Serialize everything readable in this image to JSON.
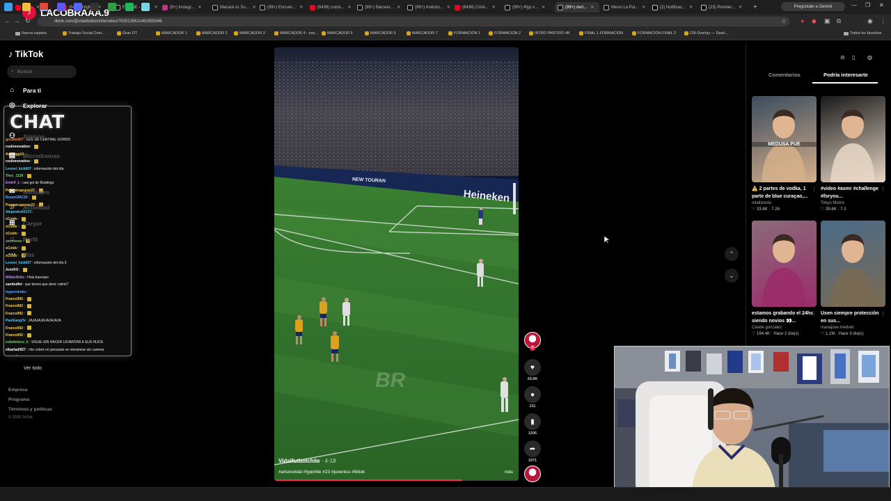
{
  "browser": {
    "tabs": [
      {
        "label": "9 B...",
        "icon": "youtube-icon"
      },
      {
        "label": "(6438) High...",
        "icon": "youtube-icon"
      },
      {
        "label": "ELNINE - Fut...",
        "icon": "page-icon"
      },
      {
        "label": "(9+) Instagr...",
        "icon": "instagram-icon"
      },
      {
        "label": "Macará vs Su...",
        "icon": "page-icon"
      },
      {
        "label": "(99+) Encuen...",
        "icon": "tiktok-icon"
      },
      {
        "label": "(6438) crack...",
        "icon": "youtube-icon"
      },
      {
        "label": "(99+) Barcelo...",
        "icon": "tiktok-icon"
      },
      {
        "label": "(99+) Anécdo...",
        "icon": "tiktok-icon"
      },
      {
        "label": "(6438) Cristi...",
        "icon": "youtube-icon"
      },
      {
        "label": "(99+) #fyp #...",
        "icon": "tiktok-icon"
      },
      {
        "label": "(99+) #art...",
        "icon": "tiktok-icon",
        "active": true
      },
      {
        "label": "Messi La Pul...",
        "icon": "tiktok-icon"
      },
      {
        "label": "(2) Notificac...",
        "icon": "x-icon"
      },
      {
        "label": "(23) Premier...",
        "icon": "x-icon"
      }
    ],
    "new_tab": "+",
    "gemini_button": "Pregúntale a Gemini",
    "url": "tiktok.com/@vidalfutbolchile/video/7630135611462659346",
    "bookmarks": [
      "Nueva carpeta",
      "Trabajo Social Com...",
      "Gran DT",
      "MARCADOR 1",
      "MARCADOR 2",
      "MARCADOR 3",
      "MARCADOR 4 - ove...",
      "MARCADOR 5",
      "MARCADOR 6",
      "MARCADOR 7",
      "FORMACION 1",
      "FORMACION 2",
      "INTRO PARTIDO 4K",
      "FINAL 1 FORMACION",
      "FORMACION FINAL 2",
      "CM Overlay — Dash..."
    ],
    "all_bookmarks": "Todos los favoritos"
  },
  "overlay": {
    "channel_name": "LACOBRAAA.9",
    "chat_title": "CHAT",
    "chat_messages": [
      {
        "user": "gordito907",
        "text": "GOL DE CENTRAL GORDO",
        "color": "#ff8a3d"
      },
      {
        "user": "rusitonovattoo",
        "text": "",
        "color": "#ffffff",
        "emote": true
      },
      {
        "user": "Aarongg10",
        "text": "",
        "color": "#ffd54a",
        "emote": false
      },
      {
        "user": "rusitonovattoo",
        "text": "",
        "color": "#ffffff",
        "emote": true
      },
      {
        "user": "Leonel_kick607",
        "text": "información del día",
        "color": "#4fd0ff"
      },
      {
        "user": "Thec_1130",
        "text": "",
        "color": "#7ad37a",
        "emote": true
      },
      {
        "user": "Endrif_1",
        "text": "casi gol de Botafogo",
        "color": "#c58bff"
      },
      {
        "user": "Pepepicapapas22",
        "text": "",
        "color": "#ffd54a",
        "emote": true
      },
      {
        "user": "BryanGMC20",
        "text": "",
        "color": "#6aa8ff",
        "emote": true
      },
      {
        "user": "Pepepicapapas22",
        "text": "",
        "color": "#ffd54a",
        "emote": true
      },
      {
        "user": "Alejandro02173",
        "text": "",
        "color": "#4fd0ff",
        "emote": false
      },
      {
        "user": "xColdv",
        "text": "",
        "color": "#ffd54a",
        "emote": true
      },
      {
        "user": "xColdv",
        "text": "",
        "color": "#ffd54a",
        "emote": true
      },
      {
        "user": "xColdv",
        "text": "",
        "color": "#ffd54a",
        "emote": true
      },
      {
        "user": "zenmorza",
        "text": "",
        "color": "#7ad37a",
        "emote": true
      },
      {
        "user": "xColdv",
        "text": "",
        "color": "#ffd54a",
        "emote": true
      },
      {
        "user": "xColdv",
        "text": "",
        "color": "#ffd54a",
        "emote": true
      },
      {
        "user": "Leonel_kick607",
        "text": "información del día 9",
        "color": "#4fd0ff"
      },
      {
        "user": "ArielXO",
        "text": "",
        "color": "#ffffff",
        "emote": true
      },
      {
        "user": "WilberBrito",
        "text": "Hola buenaso",
        "color": "#c58bff"
      },
      {
        "user": "santiedfet",
        "text": "que tienes que decir cobrix?",
        "color": "#ffffff"
      },
      {
        "user": "hyperclenko",
        "text": "",
        "color": "#6aa8ff",
        "emote": false
      },
      {
        "user": "Franco992",
        "text": "",
        "color": "#ffd54a",
        "emote": true
      },
      {
        "user": "Franco992",
        "text": "",
        "color": "#ffd54a",
        "emote": true
      },
      {
        "user": "Franco992",
        "text": "",
        "color": "#ffd54a",
        "emote": true
      },
      {
        "user": "PaulGangTe",
        "text": "JAJAJAJAJAJAJAJA",
        "color": "#4fd0ff"
      },
      {
        "user": "Franco992",
        "text": "",
        "color": "#ffd54a",
        "emote": true
      },
      {
        "user": "Franco992",
        "text": "",
        "color": "#ffd54a",
        "emote": true
      },
      {
        "user": "cobritoloco_k",
        "text": "SIGUE SIN HACER LEVANTAR A SUS HIJOS",
        "color": "#7ad37a"
      },
      {
        "user": "elbarba0927",
        "text": "che cobrix no pensaste en streamear sin camera",
        "color": "#ffffff"
      },
      {
        "user": "",
        "text": "estos días",
        "color": "#ffffff"
      }
    ]
  },
  "tiktok": {
    "logo": "TikTok",
    "search_placeholder": "Buscar",
    "nav": [
      {
        "label": "Para ti",
        "icon": "home-icon"
      },
      {
        "label": "Explorar",
        "icon": "compass-icon"
      },
      {
        "label": "Amigos",
        "icon": "friends-icon"
      },
      {
        "label": "Microdramas",
        "icon": "film-icon"
      },
      {
        "label": "Mensajes",
        "icon": "message-icon"
      },
      {
        "label": "Actividad",
        "icon": "bell-icon"
      },
      {
        "label": "Cargar",
        "icon": "upload-icon"
      },
      {
        "label": "Perfil",
        "icon": "profile-icon"
      },
      {
        "label": "Más",
        "icon": "more-icon"
      }
    ],
    "see_all": "Ver todo",
    "footer": [
      "Empresa",
      "Programa",
      "Términos y políticas"
    ],
    "copyright": "© 2026 TikTok",
    "video": {
      "author": "Vidalfutbolchile",
      "date": " · 4-18",
      "hashtags": "#arturovidal #fypchile #23 #juventus #tiktok",
      "more": "más",
      "watermark": "BR",
      "board_text": "Heineken",
      "board_text_2": "NEW TOURAN",
      "progress": 0.77
    },
    "actions": {
      "likes": "29.9K",
      "comments": "211",
      "saves": "1205",
      "shares": "1971"
    },
    "panel_tabs": {
      "comments": "Comentarios",
      "suggested": "Podría interesarte"
    },
    "suggested": [
      {
        "title": "⚠️ 2 partes de vodka, 1 parte de blue curaçao,...",
        "author": "mialtoredu",
        "likes": "33.6K",
        "date": "7-26",
        "thumb_text": "MEDUSA PUE",
        "colors": [
          "#3a4b5e",
          "#d6b08a"
        ]
      },
      {
        "title": "#video #asmr #challenge #foryou...",
        "author": "Tokyo Momo",
        "likes": "39.6K",
        "date": "7-2",
        "thumb_text": "",
        "colors": [
          "#1a1a1a",
          "#e8d7c6"
        ]
      },
      {
        "title": "estamos grabando el 24hs siendo novios 👀...",
        "author": "Cande gonzalez",
        "likes": "194.4K",
        "date": "Hace 2 día(s)",
        "thumb_text": "",
        "colors": [
          "#8a6b7a",
          "#9b2c6a"
        ]
      },
      {
        "title": "Usen siempre protección en sus...",
        "author": "mariajose.medvet",
        "likes": "1.1M",
        "date": "Hace 3 día(s)",
        "thumb_text": "",
        "colors": [
          "#4a6a8a",
          "#7a6a52"
        ]
      }
    ]
  },
  "taskbar": {
    "apps": [
      "windows-icon",
      "file-explorer-icon",
      "chrome-icon",
      "calculator-icon",
      "discord-icon",
      "obs-icon",
      "app-icon",
      "spotify-icon",
      "media-icon"
    ]
  }
}
